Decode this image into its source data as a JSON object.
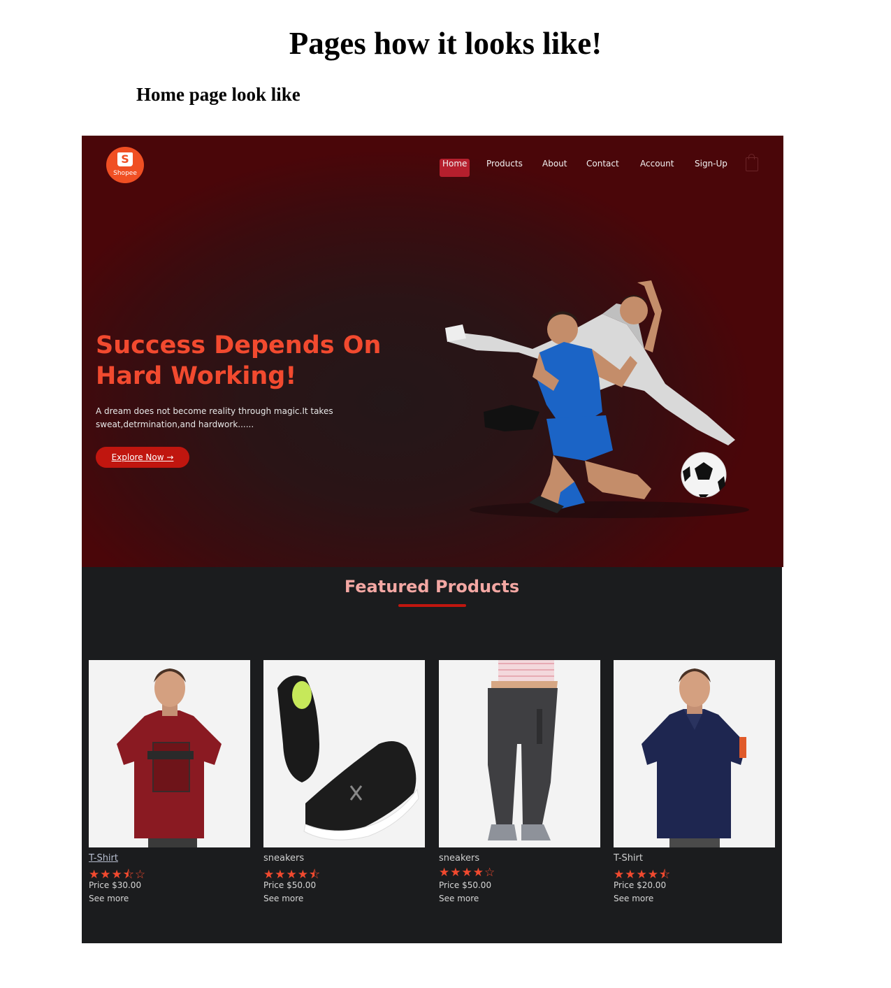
{
  "doc": {
    "title": "Pages how it looks like!",
    "subtitle": "Home page look like"
  },
  "site": {
    "logo_letter": "S",
    "logo_text": "Shopee",
    "nav": [
      "Home",
      "Products",
      "About",
      "Contact",
      "Account",
      "Sign-Up"
    ],
    "active_nav": "Home",
    "accent_color": "#f24a2f",
    "hero": {
      "heading": "Success Depends On Hard Working!",
      "description": "A dream does not become reality through magic.It takes sweat,detrmination,and hardwork......",
      "button_label": "Explore Now →"
    },
    "featured": {
      "title": "Featured Products",
      "products": [
        {
          "name": "T-Shirt",
          "rating": 3.5,
          "stars": "★★★⯪☆",
          "price": "Price $30.00",
          "more": "See more"
        },
        {
          "name": "sneakers",
          "rating": 4.5,
          "stars": "★★★★⯪",
          "price": "Price $50.00",
          "more": "See more"
        },
        {
          "name": "sneakers",
          "rating": 4,
          "stars": "★★★★☆",
          "price": "Price $50.00",
          "more": "See more"
        },
        {
          "name": "T-Shirt",
          "rating": 4.5,
          "stars": "★★★★⯪",
          "price": "Price $20.00",
          "more": "See more"
        }
      ]
    }
  }
}
